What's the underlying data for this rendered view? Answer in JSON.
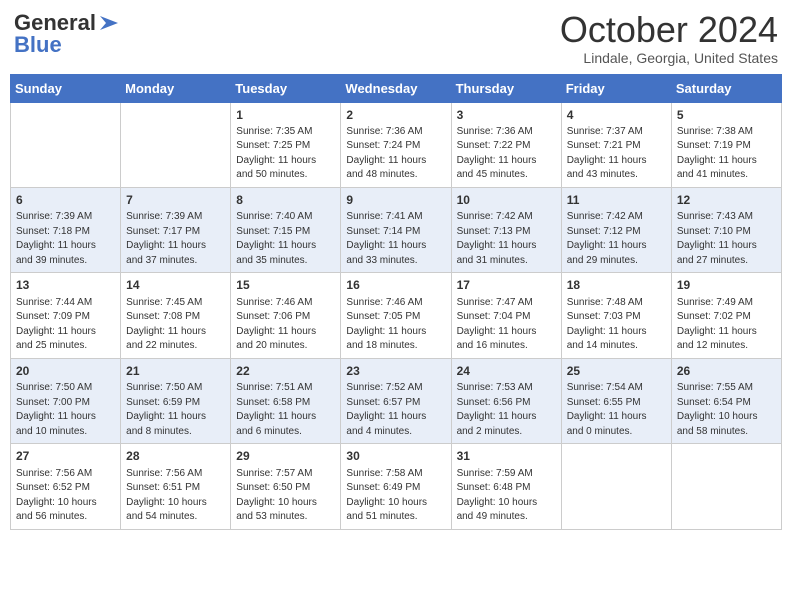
{
  "header": {
    "logo_line1": "General",
    "logo_line2": "Blue",
    "month_title": "October 2024",
    "location": "Lindale, Georgia, United States"
  },
  "weekdays": [
    "Sunday",
    "Monday",
    "Tuesday",
    "Wednesday",
    "Thursday",
    "Friday",
    "Saturday"
  ],
  "weeks": [
    [
      {
        "day": "",
        "sunrise": "",
        "sunset": "",
        "daylight": ""
      },
      {
        "day": "",
        "sunrise": "",
        "sunset": "",
        "daylight": ""
      },
      {
        "day": "1",
        "sunrise": "Sunrise: 7:35 AM",
        "sunset": "Sunset: 7:25 PM",
        "daylight": "Daylight: 11 hours and 50 minutes."
      },
      {
        "day": "2",
        "sunrise": "Sunrise: 7:36 AM",
        "sunset": "Sunset: 7:24 PM",
        "daylight": "Daylight: 11 hours and 48 minutes."
      },
      {
        "day": "3",
        "sunrise": "Sunrise: 7:36 AM",
        "sunset": "Sunset: 7:22 PM",
        "daylight": "Daylight: 11 hours and 45 minutes."
      },
      {
        "day": "4",
        "sunrise": "Sunrise: 7:37 AM",
        "sunset": "Sunset: 7:21 PM",
        "daylight": "Daylight: 11 hours and 43 minutes."
      },
      {
        "day": "5",
        "sunrise": "Sunrise: 7:38 AM",
        "sunset": "Sunset: 7:19 PM",
        "daylight": "Daylight: 11 hours and 41 minutes."
      }
    ],
    [
      {
        "day": "6",
        "sunrise": "Sunrise: 7:39 AM",
        "sunset": "Sunset: 7:18 PM",
        "daylight": "Daylight: 11 hours and 39 minutes."
      },
      {
        "day": "7",
        "sunrise": "Sunrise: 7:39 AM",
        "sunset": "Sunset: 7:17 PM",
        "daylight": "Daylight: 11 hours and 37 minutes."
      },
      {
        "day": "8",
        "sunrise": "Sunrise: 7:40 AM",
        "sunset": "Sunset: 7:15 PM",
        "daylight": "Daylight: 11 hours and 35 minutes."
      },
      {
        "day": "9",
        "sunrise": "Sunrise: 7:41 AM",
        "sunset": "Sunset: 7:14 PM",
        "daylight": "Daylight: 11 hours and 33 minutes."
      },
      {
        "day": "10",
        "sunrise": "Sunrise: 7:42 AM",
        "sunset": "Sunset: 7:13 PM",
        "daylight": "Daylight: 11 hours and 31 minutes."
      },
      {
        "day": "11",
        "sunrise": "Sunrise: 7:42 AM",
        "sunset": "Sunset: 7:12 PM",
        "daylight": "Daylight: 11 hours and 29 minutes."
      },
      {
        "day": "12",
        "sunrise": "Sunrise: 7:43 AM",
        "sunset": "Sunset: 7:10 PM",
        "daylight": "Daylight: 11 hours and 27 minutes."
      }
    ],
    [
      {
        "day": "13",
        "sunrise": "Sunrise: 7:44 AM",
        "sunset": "Sunset: 7:09 PM",
        "daylight": "Daylight: 11 hours and 25 minutes."
      },
      {
        "day": "14",
        "sunrise": "Sunrise: 7:45 AM",
        "sunset": "Sunset: 7:08 PM",
        "daylight": "Daylight: 11 hours and 22 minutes."
      },
      {
        "day": "15",
        "sunrise": "Sunrise: 7:46 AM",
        "sunset": "Sunset: 7:06 PM",
        "daylight": "Daylight: 11 hours and 20 minutes."
      },
      {
        "day": "16",
        "sunrise": "Sunrise: 7:46 AM",
        "sunset": "Sunset: 7:05 PM",
        "daylight": "Daylight: 11 hours and 18 minutes."
      },
      {
        "day": "17",
        "sunrise": "Sunrise: 7:47 AM",
        "sunset": "Sunset: 7:04 PM",
        "daylight": "Daylight: 11 hours and 16 minutes."
      },
      {
        "day": "18",
        "sunrise": "Sunrise: 7:48 AM",
        "sunset": "Sunset: 7:03 PM",
        "daylight": "Daylight: 11 hours and 14 minutes."
      },
      {
        "day": "19",
        "sunrise": "Sunrise: 7:49 AM",
        "sunset": "Sunset: 7:02 PM",
        "daylight": "Daylight: 11 hours and 12 minutes."
      }
    ],
    [
      {
        "day": "20",
        "sunrise": "Sunrise: 7:50 AM",
        "sunset": "Sunset: 7:00 PM",
        "daylight": "Daylight: 11 hours and 10 minutes."
      },
      {
        "day": "21",
        "sunrise": "Sunrise: 7:50 AM",
        "sunset": "Sunset: 6:59 PM",
        "daylight": "Daylight: 11 hours and 8 minutes."
      },
      {
        "day": "22",
        "sunrise": "Sunrise: 7:51 AM",
        "sunset": "Sunset: 6:58 PM",
        "daylight": "Daylight: 11 hours and 6 minutes."
      },
      {
        "day": "23",
        "sunrise": "Sunrise: 7:52 AM",
        "sunset": "Sunset: 6:57 PM",
        "daylight": "Daylight: 11 hours and 4 minutes."
      },
      {
        "day": "24",
        "sunrise": "Sunrise: 7:53 AM",
        "sunset": "Sunset: 6:56 PM",
        "daylight": "Daylight: 11 hours and 2 minutes."
      },
      {
        "day": "25",
        "sunrise": "Sunrise: 7:54 AM",
        "sunset": "Sunset: 6:55 PM",
        "daylight": "Daylight: 11 hours and 0 minutes."
      },
      {
        "day": "26",
        "sunrise": "Sunrise: 7:55 AM",
        "sunset": "Sunset: 6:54 PM",
        "daylight": "Daylight: 10 hours and 58 minutes."
      }
    ],
    [
      {
        "day": "27",
        "sunrise": "Sunrise: 7:56 AM",
        "sunset": "Sunset: 6:52 PM",
        "daylight": "Daylight: 10 hours and 56 minutes."
      },
      {
        "day": "28",
        "sunrise": "Sunrise: 7:56 AM",
        "sunset": "Sunset: 6:51 PM",
        "daylight": "Daylight: 10 hours and 54 minutes."
      },
      {
        "day": "29",
        "sunrise": "Sunrise: 7:57 AM",
        "sunset": "Sunset: 6:50 PM",
        "daylight": "Daylight: 10 hours and 53 minutes."
      },
      {
        "day": "30",
        "sunrise": "Sunrise: 7:58 AM",
        "sunset": "Sunset: 6:49 PM",
        "daylight": "Daylight: 10 hours and 51 minutes."
      },
      {
        "day": "31",
        "sunrise": "Sunrise: 7:59 AM",
        "sunset": "Sunset: 6:48 PM",
        "daylight": "Daylight: 10 hours and 49 minutes."
      },
      {
        "day": "",
        "sunrise": "",
        "sunset": "",
        "daylight": ""
      },
      {
        "day": "",
        "sunrise": "",
        "sunset": "",
        "daylight": ""
      }
    ]
  ]
}
